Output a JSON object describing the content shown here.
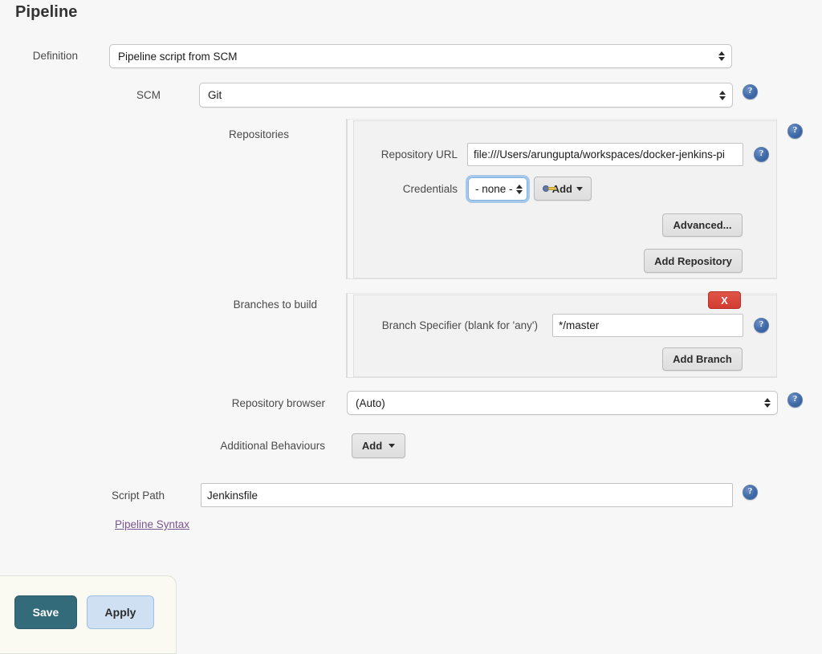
{
  "page": {
    "title": "Pipeline",
    "background_color": "#f7f7f7"
  },
  "definition": {
    "label": "Definition",
    "selected": "Pipeline script from SCM"
  },
  "scm": {
    "label": "SCM",
    "selected": "Git",
    "help_icon": "help-icon"
  },
  "repositories": {
    "label": "Repositories",
    "help_icon": "help-icon",
    "repository_url": {
      "label": "Repository URL",
      "value": "file:///Users/arungupta/workspaces/docker-jenkins-pi",
      "help_icon": "help-icon"
    },
    "credentials": {
      "label": "Credentials",
      "selected": "- none -",
      "add_button": {
        "label": "Add",
        "icon": "key-icon",
        "caret_icon": "caret-down-icon"
      }
    },
    "advanced_button": "Advanced...",
    "add_repository_button": "Add Repository"
  },
  "branches": {
    "label": "Branches to build",
    "delete_button": "X",
    "branch_specifier": {
      "label": "Branch Specifier (blank for 'any')",
      "value": "*/master",
      "help_icon": "help-icon"
    },
    "add_branch_button": "Add Branch"
  },
  "repository_browser": {
    "label": "Repository browser",
    "selected": "(Auto)",
    "help_icon": "help-icon"
  },
  "additional_behaviours": {
    "label": "Additional Behaviours",
    "add_button": "Add",
    "caret_icon": "caret-down-icon"
  },
  "script_path": {
    "label": "Script Path",
    "value": "Jenkinsfile",
    "help_icon": "help-icon"
  },
  "pipeline_syntax_link": "Pipeline Syntax",
  "footer": {
    "save_label": "Save",
    "apply_label": "Apply",
    "save_color": "#336b7a",
    "apply_color": "#cfe0f2"
  }
}
